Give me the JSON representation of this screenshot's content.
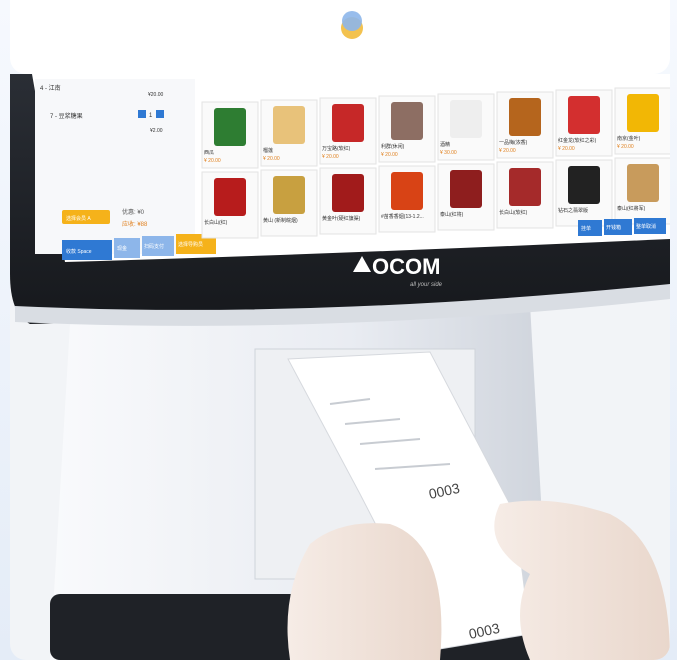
{
  "pos_screen": {
    "left_panel": {
      "items": [
        {
          "name": "4 - 江南",
          "price": "¥20.00",
          "qty": "1"
        },
        {
          "name": "7 - 豆浆糖果",
          "price": "¥2.00",
          "qty": "1"
        }
      ],
      "discount_label": "优惠: ¥0",
      "receivable_label": "应收: ¥88",
      "button_member": "选择会员 A",
      "button_checkout": "收款 Space",
      "button_cash": "现金",
      "button_pay": "扫码支付",
      "button_guide": "选择导购员"
    },
    "products": [
      {
        "name": "西瓜",
        "price": "¥ 20.00"
      },
      {
        "name": "榴莲",
        "price": "¥ 20.00"
      },
      {
        "name": "万宝路(软红)",
        "price": "¥ 20.00"
      },
      {
        "name": "利群(休闲)",
        "price": "¥ 20.00"
      },
      {
        "name": "酒精",
        "price": "¥ 30.00"
      },
      {
        "name": "一品梅(浓香)",
        "price": "¥ 20.00"
      },
      {
        "name": "红金龙(软红之彩)",
        "price": "¥ 20.00"
      },
      {
        "name": "南京(金叶)",
        "price": "¥ 20.00"
      },
      {
        "name": "长白山(红)",
        "price": ""
      },
      {
        "name": "黄山 (新制皖烟)",
        "price": ""
      },
      {
        "name": "黄金叶(硬红旗渠)",
        "price": ""
      },
      {
        "name": "#苗香香烟(13-1.2...",
        "price": ""
      },
      {
        "name": "泰山(红将)",
        "price": ""
      },
      {
        "name": "长白山(软红)",
        "price": ""
      },
      {
        "name": "钻石之翡翠版",
        "price": ""
      },
      {
        "name": "泰山(红將军)",
        "price": ""
      }
    ],
    "right_buttons": [
      "挂单",
      "开钱箱",
      "整单取消"
    ]
  },
  "brand": {
    "name": "OCOM",
    "tagline": "all your side"
  },
  "receipt_text": "0003"
}
